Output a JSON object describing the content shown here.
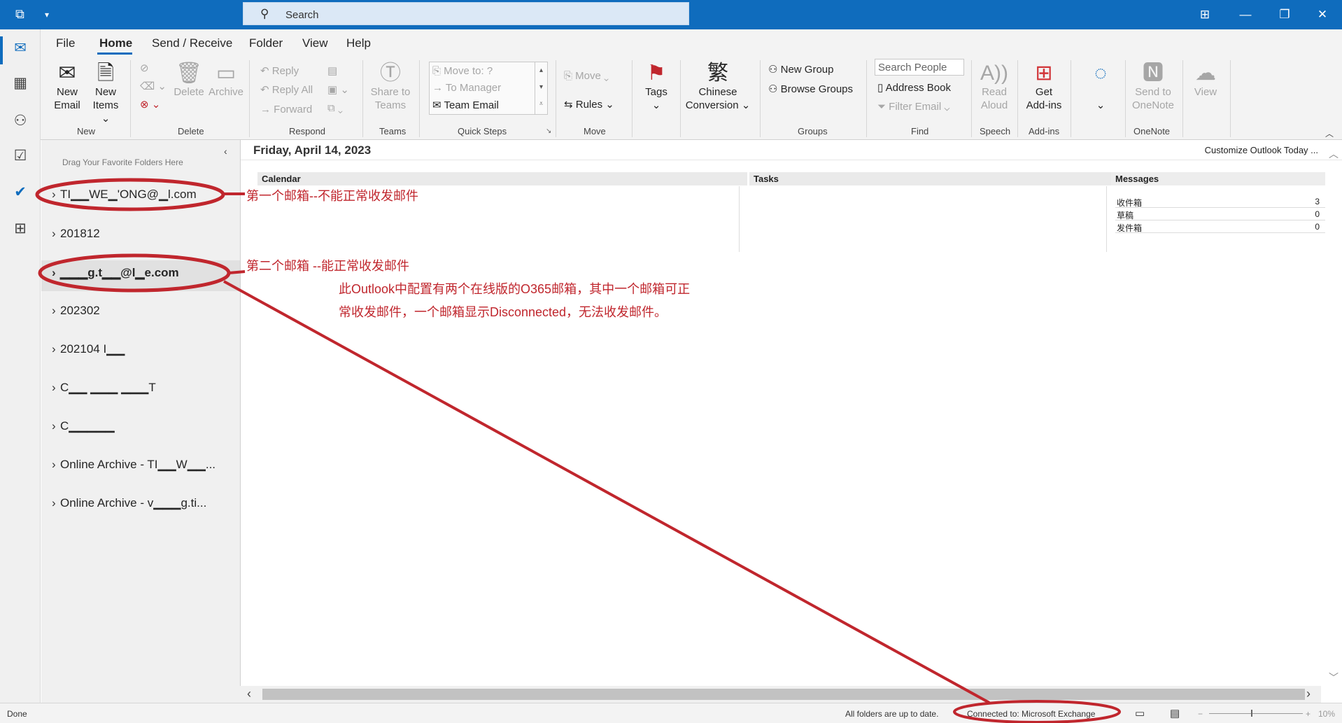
{
  "titlebar": {
    "search_placeholder": "Search",
    "icons": [
      "app-icon",
      "quick-access-chevron-icon",
      "coming-soon-icon",
      "minimize-icon",
      "restore-icon",
      "close-icon"
    ]
  },
  "ribbon_tabs": [
    "File",
    "Home",
    "Send / Receive",
    "Folder",
    "View",
    "Help"
  ],
  "ribbon": {
    "new": {
      "new_email": [
        "New",
        "Email"
      ],
      "new_items": [
        "New",
        "Items ⌄"
      ],
      "group": "New"
    },
    "delete": {
      "delete": "Delete",
      "archive": "Archive",
      "group": "Delete"
    },
    "respond": {
      "reply": "Reply",
      "reply_all": "Reply All",
      "forward": "Forward",
      "group": "Respond"
    },
    "teams": {
      "share": [
        "Share to",
        "Teams"
      ],
      "group": "Teams"
    },
    "quick_steps": {
      "items": [
        "Move to: ?",
        "To Manager",
        "Team Email"
      ],
      "group": "Quick Steps"
    },
    "move": {
      "move": "Move ⌄",
      "rules": "Rules ⌄",
      "group": "Move"
    },
    "tags": {
      "label": "Tags"
    },
    "chinese": {
      "label": [
        "Chinese",
        "Conversion ⌄"
      ]
    },
    "groups": {
      "new_group": "New Group",
      "browse_groups": "Browse Groups",
      "group": "Groups"
    },
    "find": {
      "search_people": "Search People",
      "address_book": "Address Book",
      "filter_email": "Filter Email ⌄",
      "group": "Find"
    },
    "speech": {
      "read_aloud": [
        "Read",
        "Aloud"
      ],
      "group": "Speech"
    },
    "addins": {
      "get_addins": [
        "Get",
        "Add-ins"
      ],
      "group": "Add-ins"
    },
    "onenote": {
      "send": [
        "Send to",
        "OneNote"
      ],
      "group": "OneNote"
    },
    "view": {
      "label": "View"
    }
  },
  "folder_pane": {
    "hint": "Drag Your Favorite Folders Here",
    "folders": [
      "TI▁▁WE▁'ONG@▁l.com",
      "201812",
      "▁▁▁g.t▁▁@l▁e.com",
      "202302",
      "202104 I▁▁",
      "C▁▁ ▁▁▁ ▁▁▁T",
      "C▁▁▁▁▁",
      "Online Archive - TI▁▁W▁▁...",
      "Online Archive - v▁▁▁g.ti..."
    ]
  },
  "main": {
    "date": "Friday, April 14, 2023",
    "customize": "Customize Outlook Today ...",
    "calendar_header": "Calendar",
    "tasks_header": "Tasks",
    "messages_header": "Messages",
    "messages": [
      {
        "name": "收件箱",
        "count": "3"
      },
      {
        "name": "草稿",
        "count": "0"
      },
      {
        "name": "发件箱",
        "count": "0"
      }
    ]
  },
  "annotations": {
    "first_mailbox": "第一个邮箱--不能正常收发邮件",
    "second_mailbox": "第二个邮箱 --能正常收发邮件",
    "note_line1": "此Outlook中配置有两个在线版的O365邮箱，其中一个邮箱可正",
    "note_line2": "常收发邮件，一个邮箱显示Disconnected，无法收发邮件。",
    "accent": "#c0262d"
  },
  "statusbar": {
    "left": "Done",
    "sync": "All folders are up to date.",
    "connection": "Connected to: Microsoft Exchange",
    "zoom": "10%"
  }
}
